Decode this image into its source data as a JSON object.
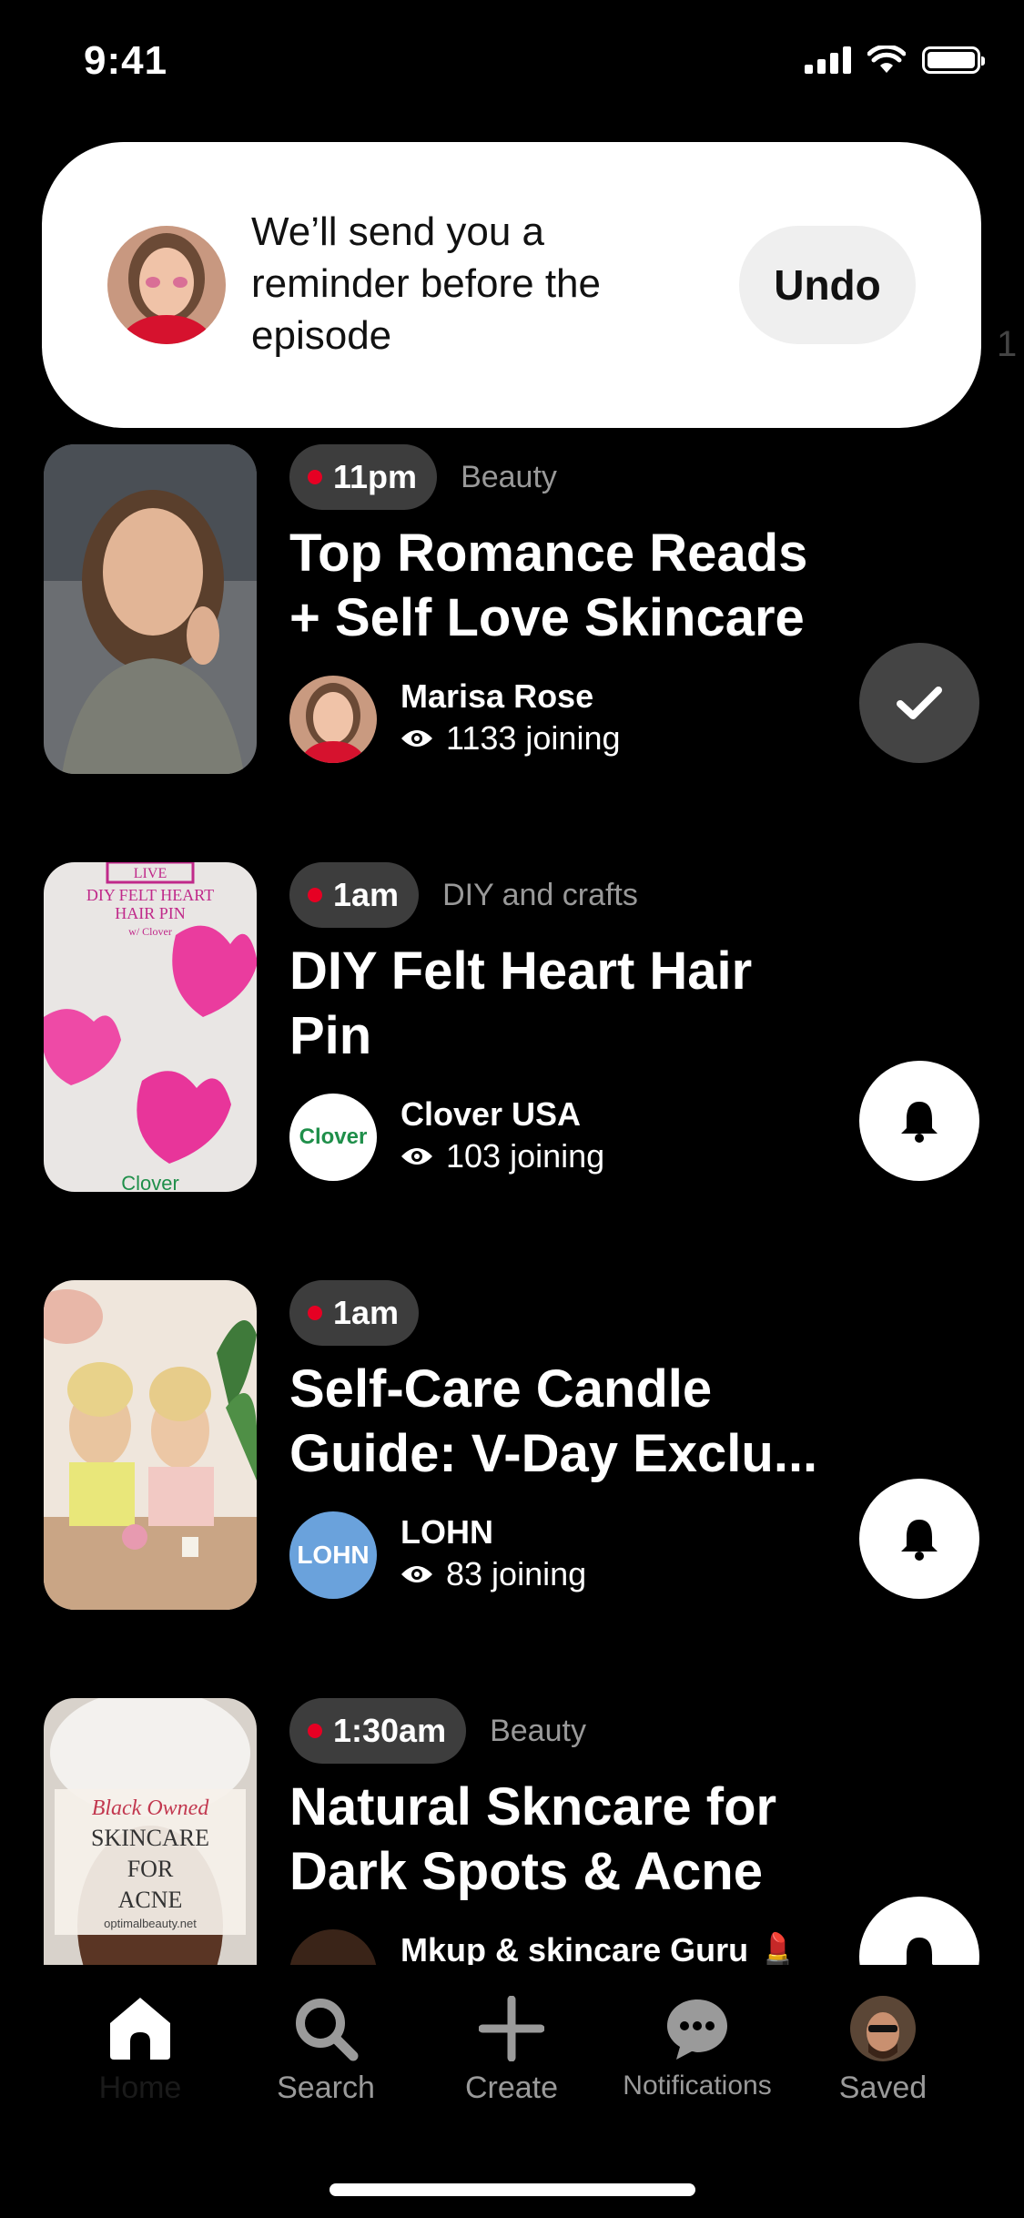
{
  "status_bar": {
    "time": "9:41"
  },
  "toast": {
    "message": "We’ll send you a reminder before the episode",
    "undo_label": "Undo"
  },
  "peek_text": "1",
  "cards": [
    {
      "time": "11pm",
      "category": "Beauty",
      "title": "Top Romance Reads + Self Love Skincare",
      "creator": "Marisa Rose",
      "joining": "1133 joining",
      "action": "reminder-set"
    },
    {
      "time": "1am",
      "category": "DIY and crafts",
      "title": "DIY Felt Heart Hair Pin",
      "creator": "Clover USA",
      "joining": "103 joining",
      "action": "remind-me",
      "thumb_lines": [
        "LIVE",
        "DIY FELT HEART",
        "HAIR PIN",
        "w/ Clover"
      ],
      "avatar_text": "Clover"
    },
    {
      "time": "1am",
      "category": "",
      "title": "Self-Care Candle Guide: V-Day Exclu...",
      "creator": "LOHN",
      "joining": "83 joining",
      "action": "remind-me",
      "avatar_text": "LOHN"
    },
    {
      "time": "1:30am",
      "category": "Beauty",
      "title": "Natural Skncare for Dark Spots & Acne",
      "creator": "Mkup & skincare Guru 💄",
      "joining": "",
      "action": "remind-me",
      "thumb_lines": [
        "Black Owned",
        "SKINCARE",
        "FOR",
        "ACNE",
        "optimalbeauty.net"
      ]
    }
  ],
  "tabs": [
    {
      "label": "Home",
      "icon": "home-icon",
      "active": true
    },
    {
      "label": "Search",
      "icon": "search-icon",
      "active": false
    },
    {
      "label": "Create",
      "icon": "plus-icon",
      "active": false
    },
    {
      "label": "Notifications",
      "icon": "chat-bubble-icon",
      "active": false
    },
    {
      "label": "Saved",
      "icon": "profile-avatar",
      "active": false
    }
  ],
  "colors": {
    "live_dot": "#e60023",
    "pill": "#3d3d3d",
    "background": "#000000",
    "toast": "#ffffff"
  }
}
